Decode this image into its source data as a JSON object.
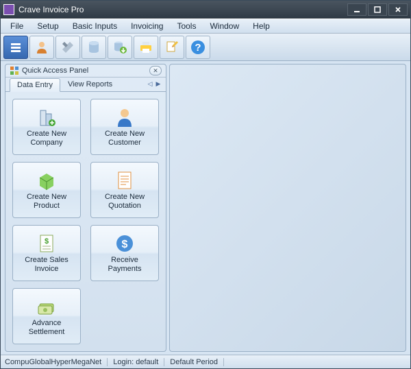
{
  "titlebar": {
    "title": "Crave Invoice Pro"
  },
  "menu": {
    "file": "File",
    "setup": "Setup",
    "basic_inputs": "Basic Inputs",
    "invoicing": "Invoicing",
    "tools": "Tools",
    "window": "Window",
    "help": "Help"
  },
  "quickpanel": {
    "title": "Quick Access Panel",
    "tabs": {
      "data_entry": "Data Entry",
      "view_reports": "View Reports"
    },
    "tiles": {
      "company": "Create New\nCompany",
      "customer": "Create New\nCustomer",
      "product": "Create New\nProduct",
      "quotation": "Create New\nQuotation",
      "sales_invoice": "Create Sales\nInvoice",
      "receive_payments": "Receive\nPayments",
      "advance_settlement": "Advance\nSettlement"
    }
  },
  "statusbar": {
    "company": "CompuGlobalHyperMegaNet",
    "login": "Login: default",
    "period": "Default Period"
  },
  "colors": {
    "accent": "#3568b0",
    "panel_border": "#9ab0c6"
  }
}
